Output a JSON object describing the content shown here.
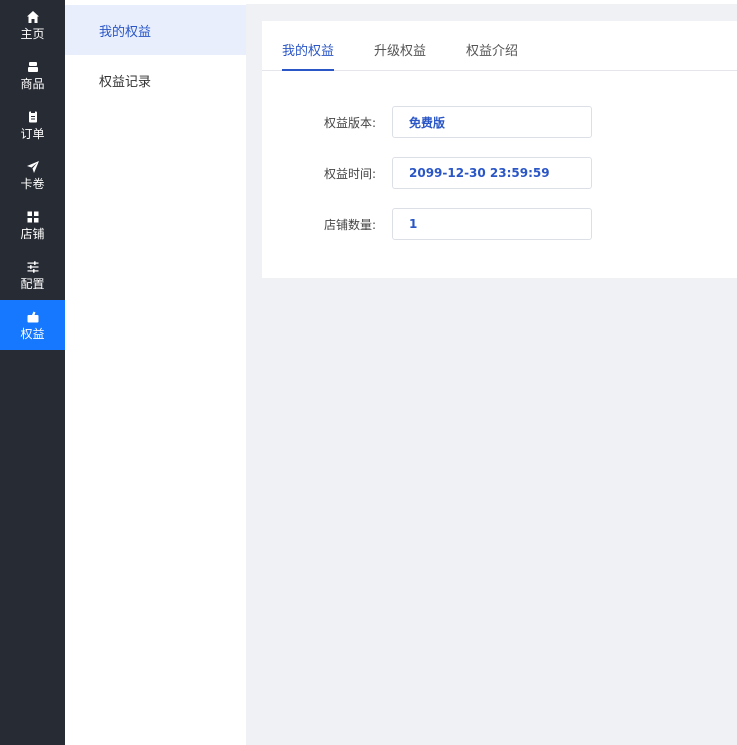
{
  "nav": {
    "items": [
      {
        "label": "主页",
        "icon": "home-icon"
      },
      {
        "label": "商品",
        "icon": "goods-icon"
      },
      {
        "label": "订单",
        "icon": "order-icon"
      },
      {
        "label": "卡卷",
        "icon": "send-icon"
      },
      {
        "label": "店铺",
        "icon": "grid-icon"
      },
      {
        "label": "配置",
        "icon": "sliders-icon"
      },
      {
        "label": "权益",
        "icon": "rights-icon"
      }
    ],
    "active_index": 6
  },
  "submenu": {
    "items": [
      {
        "label": "我的权益"
      },
      {
        "label": "权益记录"
      }
    ]
  },
  "tabs": [
    {
      "label": "我的权益"
    },
    {
      "label": "升级权益"
    },
    {
      "label": "权益介绍"
    }
  ],
  "form": {
    "version_label": "权益版本:",
    "version_value": "免费版",
    "time_label": "权益时间:",
    "time_value": "2099-12-30 23:59:59",
    "shops_label": "店铺数量:",
    "shops_value": "1"
  },
  "colors": {
    "nav_bg": "#272b33",
    "nav_active": "#1677ff",
    "accent": "#2a56c6"
  }
}
